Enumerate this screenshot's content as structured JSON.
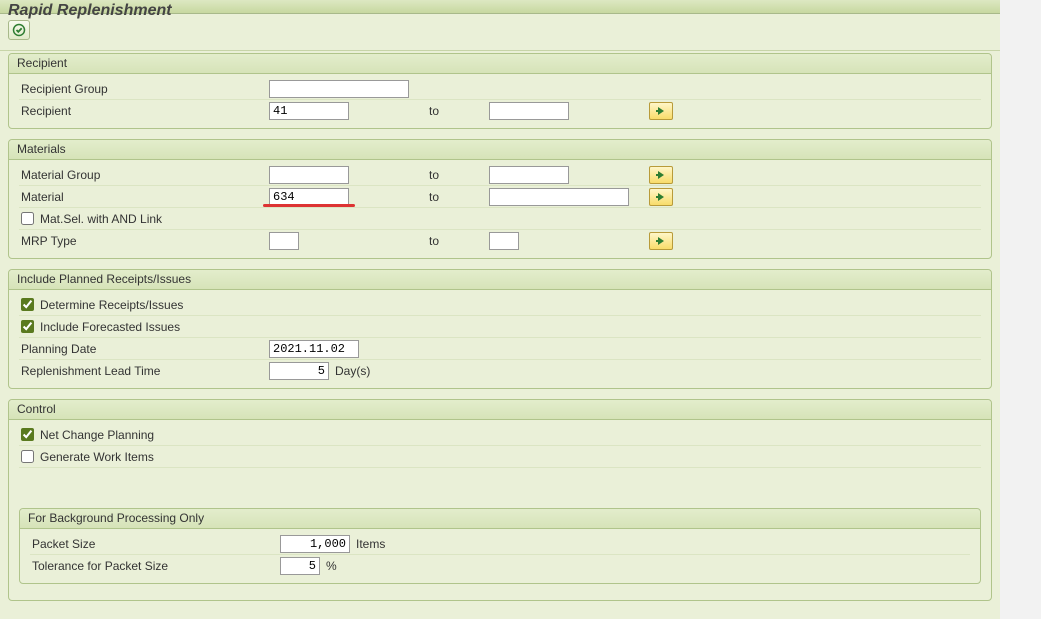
{
  "title": "Rapid Replenishment",
  "groups": {
    "recipient": {
      "title": "Recipient",
      "recipient_group_label": "Recipient Group",
      "recipient_group_value": "",
      "recipient_label": "Recipient",
      "recipient_from": "41",
      "recipient_to_label": "to",
      "recipient_to": ""
    },
    "materials": {
      "title": "Materials",
      "material_group_label": "Material Group",
      "material_group_from": "",
      "material_group_to_label": "to",
      "material_group_to": "",
      "material_label": "Material",
      "material_from": "634",
      "material_to_label": "to",
      "material_to": "",
      "matsel_label": "Mat.Sel. with AND Link",
      "matsel_checked": false,
      "mrp_type_label": "MRP Type",
      "mrp_type_from": "",
      "mrp_type_to_label": "to",
      "mrp_type_to": ""
    },
    "planned": {
      "title": "Include Planned Receipts/Issues",
      "det_label": "Determine Receipts/Issues",
      "det_checked": true,
      "forecast_label": "Include Forecasted Issues",
      "forecast_checked": true,
      "planning_date_label": "Planning Date",
      "planning_date_value": "2021.11.02",
      "rlt_label": "Replenishment Lead Time",
      "rlt_value": "5",
      "rlt_unit": "Day(s)"
    },
    "control": {
      "title": "Control",
      "net_change_label": "Net Change Planning",
      "net_change_checked": true,
      "gen_work_label": "Generate Work Items",
      "gen_work_checked": false,
      "bg": {
        "title": "For Background Processing Only",
        "packet_size_label": "Packet Size",
        "packet_size_value": "1,000",
        "packet_size_unit": "Items",
        "tolerance_label": "Tolerance for Packet Size",
        "tolerance_value": "5",
        "tolerance_unit": "%"
      }
    }
  }
}
